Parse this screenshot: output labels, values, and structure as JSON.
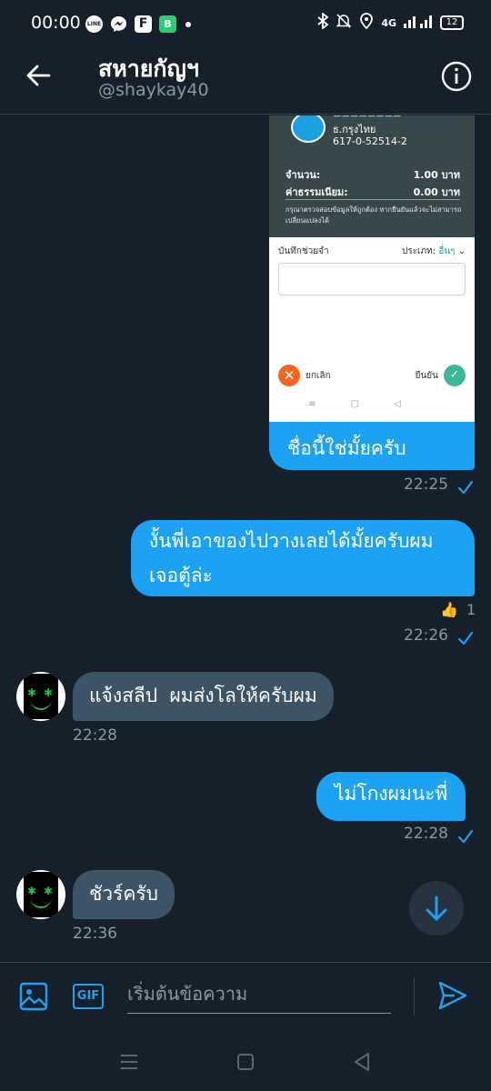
{
  "status_bar": {
    "time": "00:00",
    "apps": [
      "LINE",
      "messenger",
      "F",
      "B"
    ],
    "network": "4G",
    "battery": "12"
  },
  "header": {
    "name": "สหายกัญฯ",
    "handle": "@shaykay40"
  },
  "messages": {
    "image_msg": {
      "bank_name": "ธ.กรุงไทย",
      "account": "617-0-52514-2",
      "amount_label": "จำนวน:",
      "amount_value": "1.00 บาท",
      "fee_label": "ค่าธรรมเนียม:",
      "fee_value": "0.00 บาท",
      "note": "กรุณาตรวจสอบข้อมูลให้ถูกต้อง หากยืนยันแล้วจะไม่สามารถเปลี่ยนแปลงได้",
      "memo_label": "บันทึกช่วยจำ",
      "memo_type_label": "ประเภท:",
      "memo_type_value": "อื่นๆ",
      "cancel_label": "ยกเลิก",
      "confirm_label": "ยืนยัน",
      "caption": "ชื่อนี้ใช่มั้ยครับ",
      "time": "22:25"
    },
    "msg2": {
      "line1": "งั้นพี่เอาของไปวางเลยได้มั้ยครับผม",
      "line2": "เจอตู้ล่ะ",
      "reaction_count": "1",
      "time": "22:26"
    },
    "msg3": {
      "text": "แจ้งสลีป  ผมส่งโลให้ครับผม",
      "time": "22:28"
    },
    "msg4": {
      "text": "ไม่โกงผมนะพี่",
      "time": "22:28"
    },
    "msg5": {
      "text": "ชัวร์ครับ",
      "time": "22:36"
    }
  },
  "composer": {
    "placeholder": "เริ่มต้นข้อความ",
    "gif_label": "GIF"
  },
  "colors": {
    "background": "#15202b",
    "accent": "#1da1f2",
    "incoming_bubble": "#3d5466",
    "muted_text": "#8899a6"
  }
}
